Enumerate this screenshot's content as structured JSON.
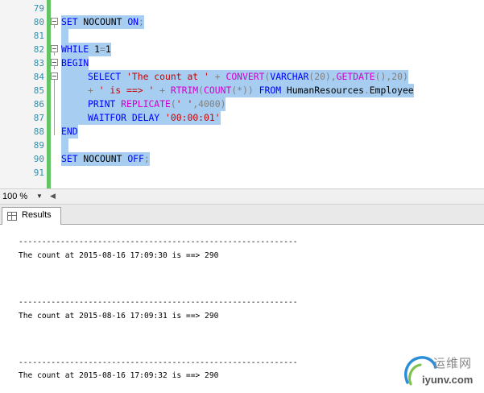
{
  "editor": {
    "lines": [
      {
        "num": "79"
      },
      {
        "num": "80"
      },
      {
        "num": "81"
      },
      {
        "num": "82"
      },
      {
        "num": "83"
      },
      {
        "num": "84"
      },
      {
        "num": "85"
      },
      {
        "num": "86"
      },
      {
        "num": "87"
      },
      {
        "num": "88"
      },
      {
        "num": "89"
      },
      {
        "num": "90"
      },
      {
        "num": "91"
      }
    ],
    "tokens": {
      "l80": [
        "SET",
        " NOCOUNT ",
        "ON",
        ";"
      ],
      "l82": [
        "WHILE",
        " 1",
        "=",
        "1"
      ],
      "l83": [
        "BEGIN"
      ],
      "l84": [
        "SELECT",
        " ",
        "'The count at '",
        " + ",
        "CONVERT",
        "(",
        "VARCHAR",
        "(20)",
        ",",
        "GETDATE",
        "(),20)"
      ],
      "l85": [
        "+",
        " ",
        "' is ==> '",
        " + ",
        "RTRIM",
        "(",
        "COUNT",
        "(*))",
        " ",
        "FROM",
        " HumanResources",
        ".",
        "Employee"
      ],
      "l86": [
        "PRINT",
        " ",
        "REPLICATE",
        "(",
        "' '",
        ",4000)"
      ],
      "l87": [
        "WAITFOR",
        " ",
        "DELAY",
        " ",
        "'00:00:01'"
      ],
      "l88": [
        "END"
      ],
      "l90": [
        "SET",
        " NOCOUNT ",
        "OFF",
        ";"
      ]
    }
  },
  "zoom": {
    "value": "100 %"
  },
  "tabs": {
    "results_label": "Results"
  },
  "results": {
    "separator": "------------------------------------------------------------",
    "rows": [
      "The count at 2015-08-16 17:09:30 is ==> 290",
      "The count at 2015-08-16 17:09:31 is ==> 290",
      "The count at 2015-08-16 17:09:32 is ==> 290"
    ]
  },
  "watermark": {
    "cn": "运维网",
    "url": "iyunv.com"
  }
}
